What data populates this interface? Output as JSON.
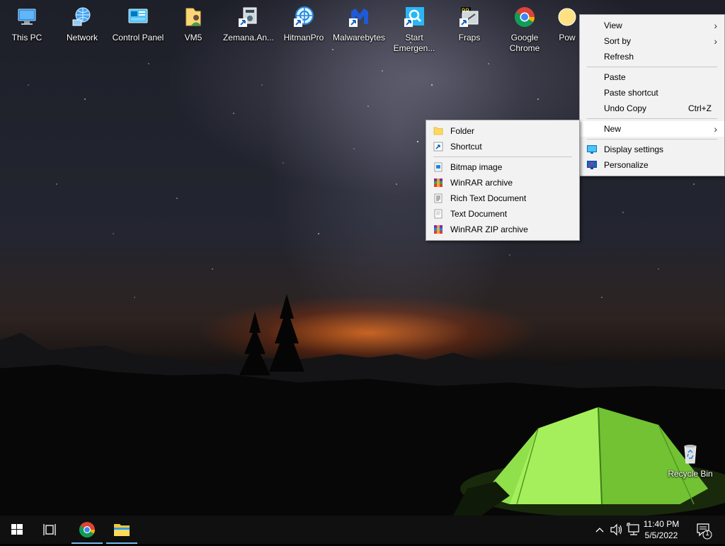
{
  "desktop": {
    "icons": [
      {
        "label": "This PC",
        "icon": "this-pc-icon"
      },
      {
        "label": "Network",
        "icon": "network-icon"
      },
      {
        "label": "Control Panel",
        "icon": "control-panel-icon"
      },
      {
        "label": "VM5",
        "icon": "user-folder-icon"
      },
      {
        "label": "Zemana.An...",
        "icon": "installer-icon"
      },
      {
        "label": "HitmanPro",
        "icon": "hitmanpro-icon"
      },
      {
        "label": "Malwarebytes",
        "icon": "malwarebytes-icon"
      },
      {
        "label": "Start Emergen...",
        "icon": "emergency-kit-icon"
      },
      {
        "label": "Fraps",
        "icon": "fraps-icon"
      },
      {
        "label": "Google Chrome",
        "icon": "chrome-icon"
      },
      {
        "label": "Pow",
        "icon": "power-icon"
      }
    ],
    "recycle_bin": {
      "label": "Recycle Bin",
      "icon": "recycle-bin-icon"
    }
  },
  "context_menu": {
    "items": [
      {
        "label": "View",
        "submenu": true
      },
      {
        "label": "Sort by",
        "submenu": true
      },
      {
        "label": "Refresh"
      },
      {
        "label": "Paste"
      },
      {
        "label": "Paste shortcut"
      },
      {
        "label": "Undo Copy",
        "shortcut": "Ctrl+Z"
      },
      {
        "label": "New",
        "submenu": true,
        "highlighted": true
      },
      {
        "label": "Display settings",
        "icon": "display-settings-icon"
      },
      {
        "label": "Personalize",
        "icon": "personalize-icon"
      }
    ]
  },
  "new_submenu": {
    "items": [
      {
        "label": "Folder",
        "icon": "folder-icon"
      },
      {
        "label": "Shortcut",
        "icon": "shortcut-icon"
      },
      {
        "label": "Bitmap image",
        "icon": "bitmap-icon"
      },
      {
        "label": "WinRAR archive",
        "icon": "winrar-icon"
      },
      {
        "label": "Rich Text Document",
        "icon": "rich-text-icon"
      },
      {
        "label": "Text Document",
        "icon": "text-document-icon"
      },
      {
        "label": "WinRAR ZIP archive",
        "icon": "winrar-zip-icon"
      }
    ]
  },
  "taskbar": {
    "start": "windows-logo-icon",
    "task_view": "task-view-icon",
    "pinned": [
      {
        "name": "Google Chrome",
        "icon": "chrome-icon",
        "active": true
      },
      {
        "name": "File Explorer",
        "icon": "file-explorer-icon",
        "active": true
      }
    ],
    "tray": {
      "time": "11:40 PM",
      "date": "5/5/2022",
      "notification_count": "1"
    }
  },
  "colors": {
    "menu_bg": "#f2f2f2",
    "menu_highlight": "#ffffff",
    "taskbar_bg": "#101010",
    "taskbar_accent": "#76b9ed",
    "tent_green": "#8fe04a"
  }
}
